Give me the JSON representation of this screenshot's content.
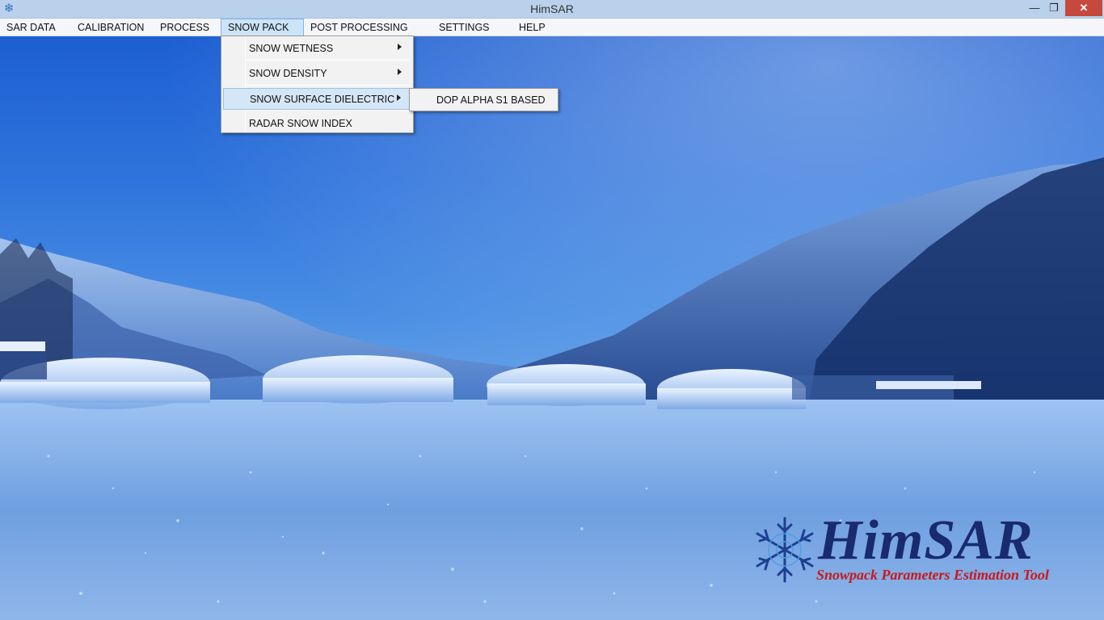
{
  "window": {
    "title": "HimSAR",
    "minimize_glyph": "—",
    "maximize_glyph": "❐",
    "close_glyph": "✕"
  },
  "menubar": {
    "items": [
      {
        "label": "SAR DATA"
      },
      {
        "label": "CALIBRATION"
      },
      {
        "label": "PROCESS"
      },
      {
        "label": "SNOW PACK"
      },
      {
        "label": "POST PROCESSING"
      },
      {
        "label": "SETTINGS"
      },
      {
        "label": "HELP"
      }
    ],
    "active": "SNOW PACK"
  },
  "snowpack_menu": {
    "items": [
      {
        "label": "SNOW WETNESS",
        "has_submenu": true
      },
      {
        "label": "SNOW DENSITY",
        "has_submenu": true
      },
      {
        "label": "SNOW SURFACE DIELECTRIC",
        "has_submenu": true
      },
      {
        "label": "RADAR SNOW INDEX",
        "has_submenu": false
      }
    ],
    "highlighted": "SNOW SURFACE DIELECTRIC"
  },
  "submenu": {
    "items": [
      {
        "label": "DOP ALPHA S1 BASED"
      }
    ]
  },
  "logo": {
    "brand": "HimSAR",
    "tagline": "Snowpack Parameters Estimation Tool",
    "icon": "snowflake-icon"
  },
  "colors": {
    "titlebar": "#b9d1ea",
    "close_button": "#c7483c",
    "menu_highlight": "#cce4f7",
    "brand_text": "#1a2a6e",
    "tagline_text": "#c8191e"
  }
}
